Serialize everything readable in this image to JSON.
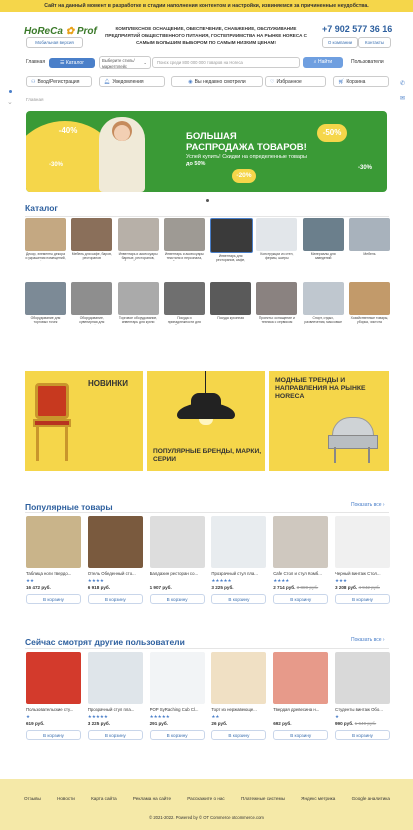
{
  "topbar": "Сайт на данный момент в разработке в стадии наполнения контентом и настройки, извиняемся за причиненные неудобства.",
  "logo": {
    "a": "HoReCa",
    "b": "Prof"
  },
  "mobile_version": "Мобильная версия",
  "header_text": "КОМПЛЕКСНОЕ ОСНАЩЕНИЕ, ОБЕСПЕЧЕНИЕ, СНАБЖЕНИЕ, ОБСЛУЖИВАНИЕ ПРЕДПРИЯТИЙ ОБЩЕСТВЕННОГО ПИТАНИЯ, ГОСТЕПРИИМСТВА НА РЫНКЕ HORECA С САМЫМ БОЛЬШИМ ВЫБОРОМ ПО САМЫМ НИЗКИМ ЦЕНАМ!",
  "phone": "+7 902 577 36 16",
  "about": "О компании",
  "contacts": "Контакты",
  "nav": {
    "home": "Главная",
    "catalog": "Каталог",
    "select": "Выберите стиль/ маркетплейс",
    "search_placeholder": "Поиск среди 800 000 000 товаров на Horeca",
    "find": "Найти",
    "users": "Пользователи"
  },
  "toolbar": {
    "login": "Вход/Регистрация",
    "notifications": "Уведомления",
    "viewed": "Вы недавно смотрели",
    "favorites": "Избранное",
    "cart": "Корзина"
  },
  "breadcrumb": "Главная",
  "banner": {
    "title1": "БОЛЬШАЯ",
    "title2": "РАСПРОДАЖА ТОВАРОВ!",
    "sub1": "Успей купить! Скидки на определенные товары",
    "sub2": "до 50%",
    "p1": "-40%",
    "p2": "-30%",
    "p3": "-50%",
    "p4": "-20%",
    "p5": "-30%"
  },
  "catalog_title": "Каталог",
  "catalog_row1": [
    "Декор, элементы декора и украшения помещений, фигуры",
    "Мебель для кафе, баров, ресторанов",
    "Инвентарь и аксессуары барные, ресторанов, бассейн и прочее",
    "Инвентарь и аксессуары текстиля и персонала, обслуживающего",
    "Инвентарь для ресторанов, кафе, горячих и холодных",
    "Конструкции из стен, фермы, шатры",
    "Материалы для заведений",
    "Мебель"
  ],
  "catalog_row2": [
    "Оборудование для торговых точек",
    "Оборудование, сувенирная для интерьера и оформления",
    "Торговое оборудование, инвентарь для кухни",
    "Посуда и принадлежности для обслуживания",
    "Посуда кухонная",
    "Проекты: оснащение и техника с сервисом",
    "Спорт, отдых, развлечения, массовые мероприятия",
    "Хозяйственные товары, уборка, чистота"
  ],
  "promo": {
    "new": "НОВИНКИ",
    "brands": "ПОПУЛЯРНЫЕ БРЕНДЫ, МАРКИ, СЕРИИ",
    "trends": "МОДНЫЕ ТРЕНДЫ И НАПРАВЛЕНИЯ НА РЫНКЕ HORECA"
  },
  "popular_title": "Популярные товары",
  "show_all": "Показать все",
  "popular": [
    {
      "name": "Таблица ноги твердо...",
      "stars": "★★",
      "price": "16 472 руб.",
      "old": "",
      "cart": "В корзину"
    },
    {
      "name": "Отель Обеденный сто...",
      "stars": "★★★★",
      "price": "6 918 руб.",
      "old": "",
      "cart": "В корзину"
    },
    {
      "name": "Балдахин ресторан со...",
      "stars": "",
      "price": "1 907 руб.",
      "old": "",
      "cart": "В корзину"
    },
    {
      "name": "Прозрачный стул пла...",
      "stars": "★★★★★",
      "price": "3 225 руб.",
      "old": "",
      "cart": "В корзину"
    },
    {
      "name": "Cafe Стол и стул Комб...",
      "stars": "★★★★",
      "price": "2 714 руб.",
      "old": "3 889 руб.",
      "cart": "В корзину"
    },
    {
      "name": "Черный винтаж Стол...",
      "stars": "★★★",
      "price": "3 208 руб.",
      "old": "4 942 руб.",
      "cart": "В корзину"
    }
  ],
  "others_title": "Сейчас смотрят другие пользователи",
  "others": [
    {
      "name": "Пользовательские сту...",
      "stars": "★",
      "price": "619 руб.",
      "old": "",
      "cart": "В корзину"
    },
    {
      "name": "Прозрачный стул пла...",
      "stars": "★★★★★",
      "price": "3 225 руб.",
      "old": "",
      "cart": "В корзину"
    },
    {
      "name": "POP SyRaching Cub Cl...",
      "stars": "★★★★★",
      "price": "291 руб.",
      "old": "",
      "cart": "В корзину"
    },
    {
      "name": "Торт из нержавеюще...",
      "stars": "★★",
      "price": "26 руб.",
      "old": "",
      "cart": "В корзину"
    },
    {
      "name": "Твердая древесина н...",
      "stars": "",
      "price": "692 руб.",
      "old": "",
      "cart": "В корзину"
    },
    {
      "name": "Студенты винтаж Обо...",
      "stars": "★",
      "price": "990 руб.",
      "old": "1 649 руб.",
      "cart": "В корзину"
    }
  ],
  "footer": {
    "links": [
      "Отзывы",
      "Новости",
      "Карта сайта",
      "Реклама на сайте",
      "Расскажите о нас",
      "Платежные системы",
      "Яндекс метрика",
      "Google аналитика"
    ],
    "copyright": "© 2021-2022. Powered by © OT Commerce otcommerce.com"
  }
}
